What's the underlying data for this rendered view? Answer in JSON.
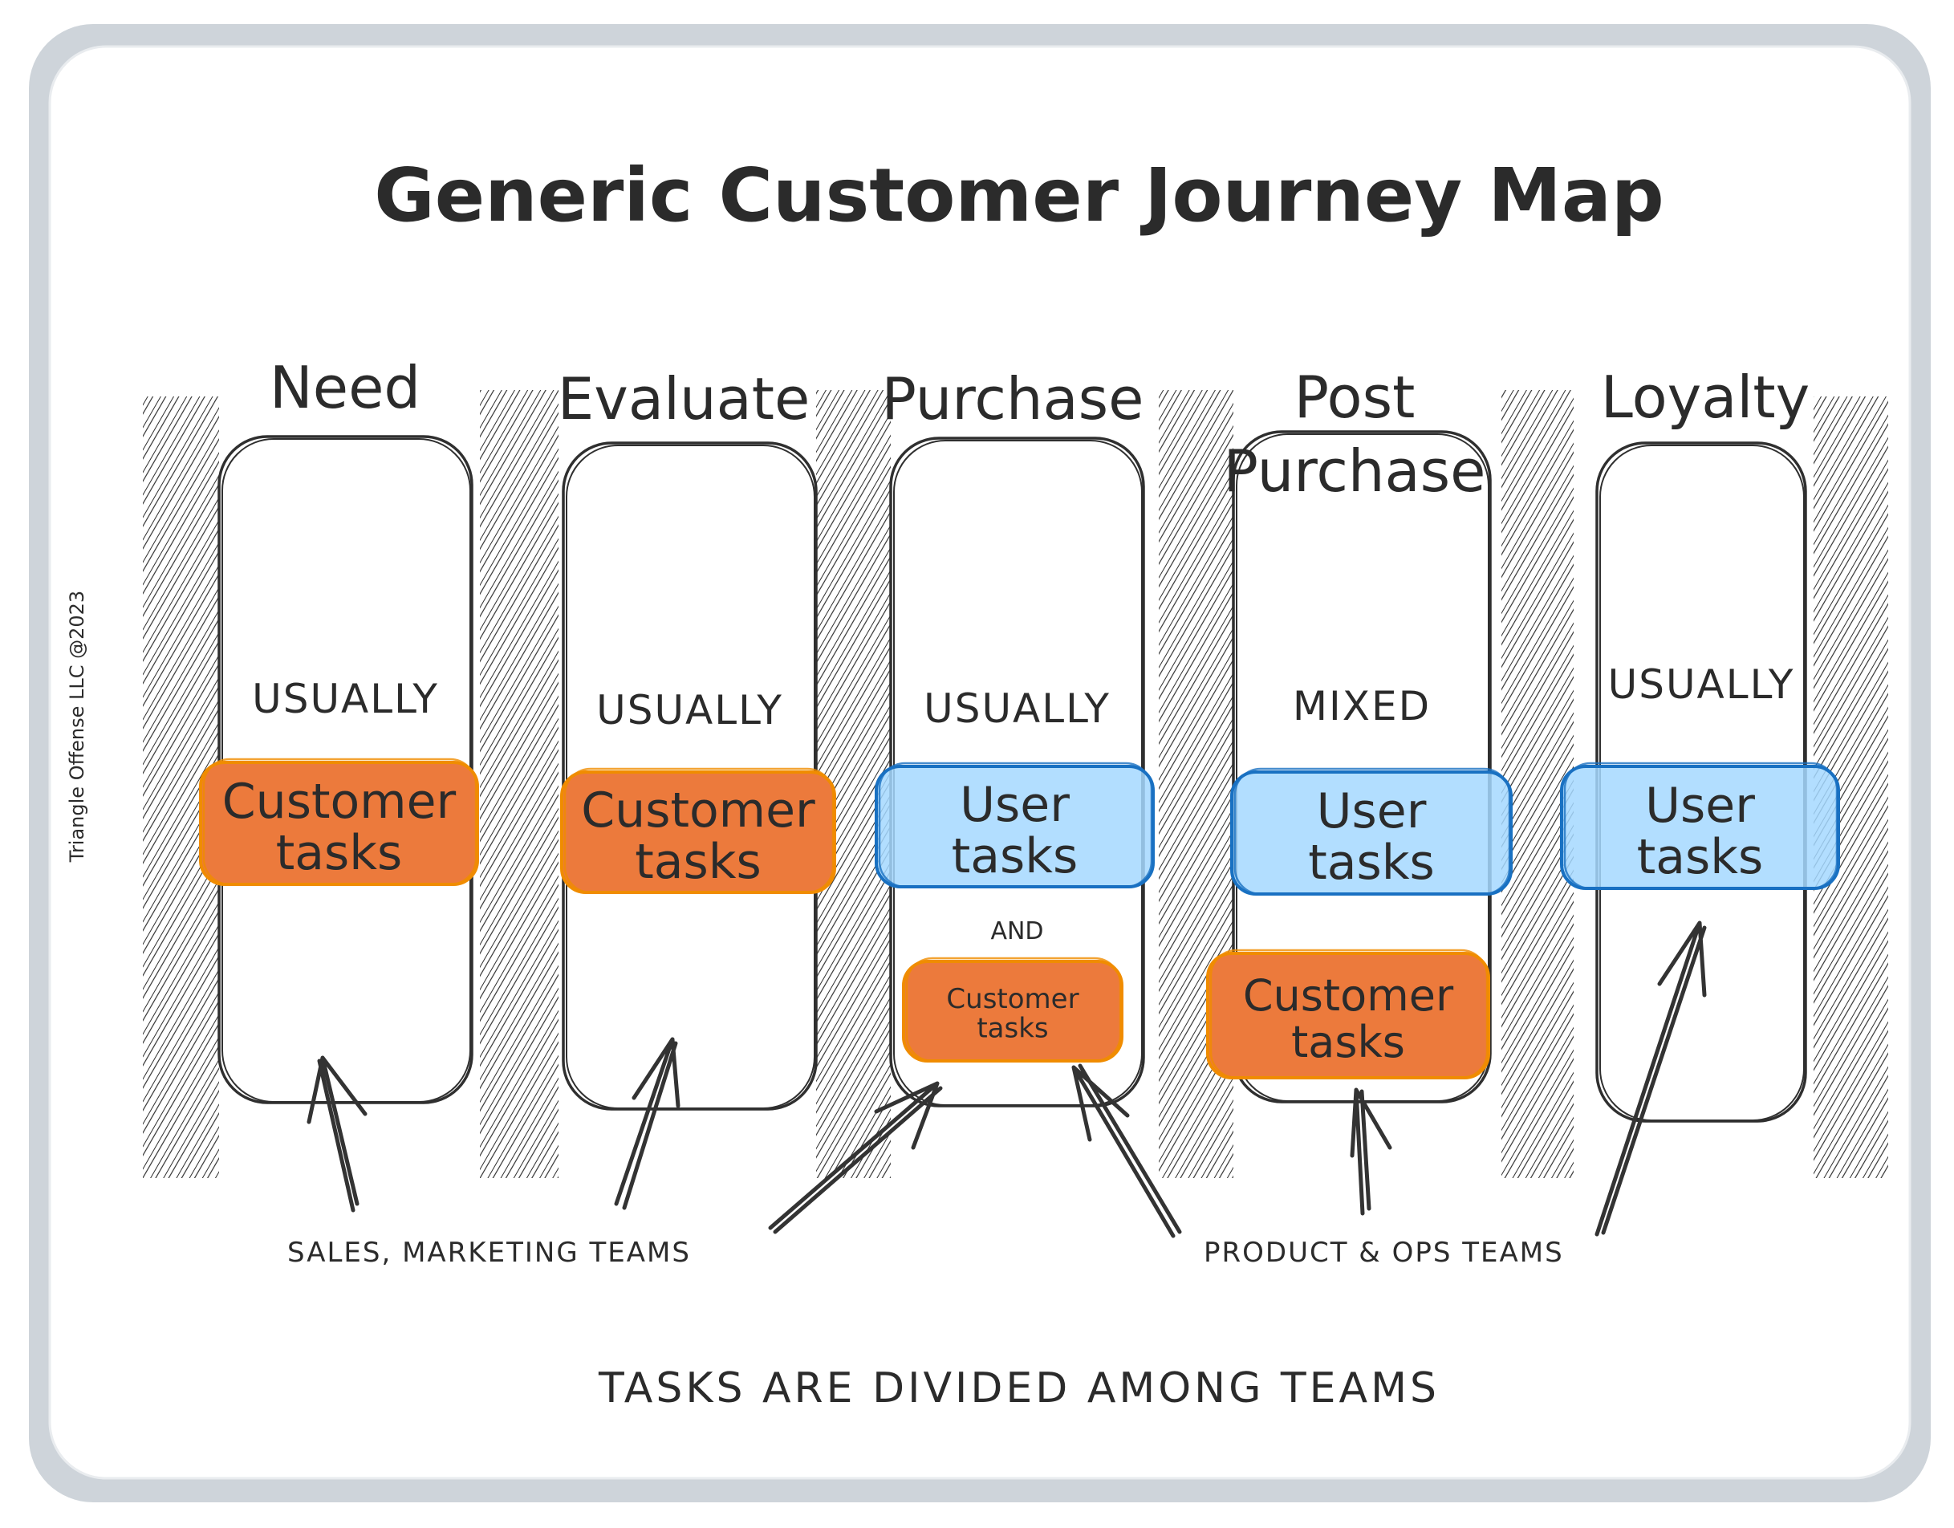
{
  "title": "Generic Customer Journey Map",
  "watermark": "Triangle Offense LLC @2023",
  "colors": {
    "ink": "#2f2f2f",
    "frame": "#ced4da",
    "customer_fill": "#ec7a3c",
    "customer_stroke": "#f08c00",
    "user_fill": "#a5d8ff",
    "user_stroke": "#1971c2"
  },
  "stages": [
    {
      "name_lines": [
        "Need"
      ],
      "qualifier": "USUALLY",
      "primary_task": {
        "type": "customer",
        "lines": [
          "Customer",
          "tasks"
        ]
      },
      "secondary": null
    },
    {
      "name_lines": [
        "Evaluate"
      ],
      "qualifier": "USUALLY",
      "primary_task": {
        "type": "customer",
        "lines": [
          "Customer",
          "tasks"
        ]
      },
      "secondary": null
    },
    {
      "name_lines": [
        "Purchase"
      ],
      "qualifier": "USUALLY",
      "primary_task": {
        "type": "user",
        "lines": [
          "User",
          "tasks"
        ]
      },
      "connector": "AND",
      "secondary": {
        "type": "customer",
        "lines": [
          "Customer",
          "tasks"
        ]
      }
    },
    {
      "name_lines": [
        "Post",
        "Purchase"
      ],
      "qualifier": "MIXED",
      "primary_task": {
        "type": "user",
        "lines": [
          "User",
          "tasks"
        ]
      },
      "secondary": {
        "type": "customer",
        "lines": [
          "Customer",
          "tasks"
        ]
      }
    },
    {
      "name_lines": [
        "Loyalty"
      ],
      "qualifier": "USUALLY",
      "primary_task": {
        "type": "user",
        "lines": [
          "User",
          "tasks"
        ]
      },
      "secondary": null
    }
  ],
  "team_labels": {
    "sales_marketing": "SALES, MARKETING TEAMS",
    "product_ops": "PRODUCT & OPS TEAMS"
  },
  "footer": "TASKS ARE DIVIDED AMONG TEAMS"
}
